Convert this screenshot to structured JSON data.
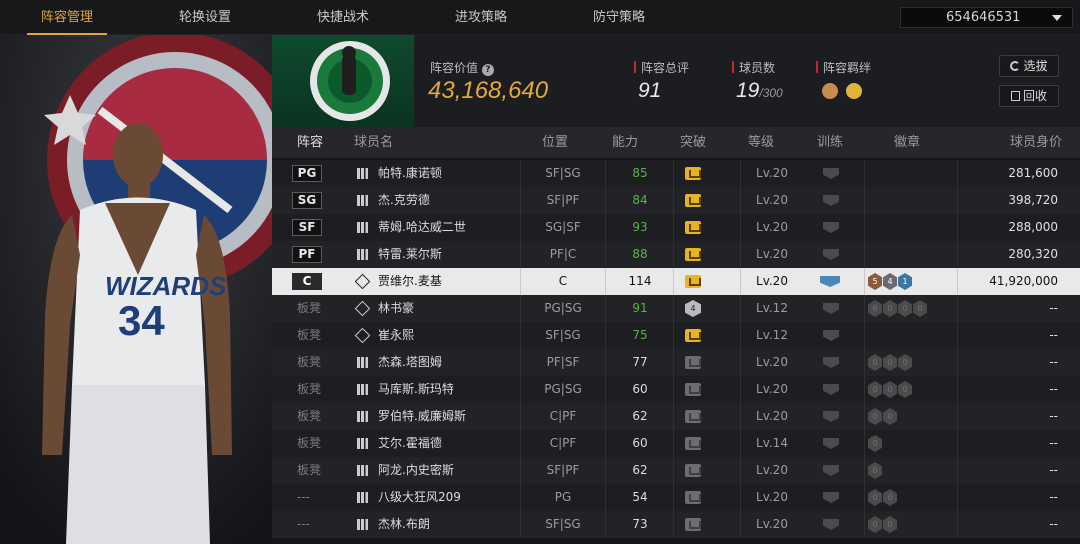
{
  "tabs": [
    "阵容管理",
    "轮换设置",
    "快捷战术",
    "进攻策略",
    "防守策略"
  ],
  "account": "654646531",
  "header": {
    "value_label": "阵容价值",
    "value": "43,168,640",
    "rating_label": "阵容总评",
    "rating": "91",
    "players_label": "球员数",
    "players": "19",
    "players_max": "/300",
    "bond_label": "阵容羁绊",
    "btn_select": "选拔",
    "btn_recycle": "回收"
  },
  "columns": [
    "阵容",
    "球员名",
    "位置",
    "能力",
    "突破",
    "等级",
    "训练",
    "徽章",
    "球员身价"
  ],
  "featured_player_jersey": "34",
  "rows": [
    {
      "slot": "PG",
      "name": "帕特.康诺顿",
      "pos": "SF|SG",
      "ability": "85",
      "green": true,
      "breakthrough": "gold",
      "level": "Lv.20",
      "badges": [],
      "value": "281,600"
    },
    {
      "slot": "SG",
      "name": "杰.克劳德",
      "pos": "SF|PF",
      "ability": "84",
      "green": true,
      "breakthrough": "gold",
      "level": "Lv.20",
      "badges": [],
      "value": "398,720"
    },
    {
      "slot": "SF",
      "name": "蒂姆.哈达威二世",
      "pos": "SG|SF",
      "ability": "93",
      "green": true,
      "breakthrough": "gold",
      "level": "Lv.20",
      "badges": [],
      "value": "288,000"
    },
    {
      "slot": "PF",
      "name": "特雷.莱尔斯",
      "pos": "PF|C",
      "ability": "88",
      "green": true,
      "breakthrough": "gold",
      "level": "Lv.20",
      "badges": [],
      "value": "280,320"
    },
    {
      "slot": "C",
      "name": "贾维尔.麦基",
      "pos": "C",
      "ability": "114",
      "green": false,
      "breakthrough": "gold",
      "level": "Lv.20",
      "badges": [
        "5",
        "4",
        "1"
      ],
      "value": "41,920,000",
      "selected": true
    },
    {
      "slot": "板凳",
      "name": "林书豪",
      "pos": "PG|SG",
      "ability": "91",
      "green": true,
      "breakthrough": "4",
      "level": "Lv.12",
      "badges": [
        "6",
        "0",
        "0",
        "0"
      ],
      "value": "--"
    },
    {
      "slot": "板凳",
      "name": "崔永熙",
      "pos": "SF|SG",
      "ability": "75",
      "green": true,
      "breakthrough": "gold",
      "level": "Lv.12",
      "badges": [],
      "value": "--"
    },
    {
      "slot": "板凳",
      "name": "杰森.塔图姆",
      "pos": "PF|SF",
      "ability": "77",
      "green": false,
      "breakthrough": "grey",
      "level": "Lv.20",
      "badges": [
        "0",
        "0",
        "0"
      ],
      "value": "--"
    },
    {
      "slot": "板凳",
      "name": "马库斯.斯玛特",
      "pos": "PG|SG",
      "ability": "60",
      "green": false,
      "breakthrough": "grey",
      "level": "Lv.20",
      "badges": [
        "0",
        "0",
        "0"
      ],
      "value": "--"
    },
    {
      "slot": "板凳",
      "name": "罗伯特.威廉姆斯",
      "pos": "C|PF",
      "ability": "62",
      "green": false,
      "breakthrough": "grey",
      "level": "Lv.20",
      "badges": [
        "0",
        "0"
      ],
      "value": "--"
    },
    {
      "slot": "板凳",
      "name": "艾尔.霍福德",
      "pos": "C|PF",
      "ability": "60",
      "green": false,
      "breakthrough": "grey",
      "level": "Lv.14",
      "badges": [
        "0"
      ],
      "value": "--"
    },
    {
      "slot": "板凳",
      "name": "阿龙.内史密斯",
      "pos": "SF|PF",
      "ability": "62",
      "green": false,
      "breakthrough": "grey",
      "level": "Lv.20",
      "badges": [
        "0"
      ],
      "value": "--"
    },
    {
      "slot": "---",
      "name": "八级大狂风209",
      "pos": "PG",
      "ability": "54",
      "green": false,
      "breakthrough": "grey",
      "level": "Lv.20",
      "badges": [
        "0",
        "0"
      ],
      "value": "--"
    },
    {
      "slot": "---",
      "name": "杰林.布朗",
      "pos": "SF|SG",
      "ability": "73",
      "green": false,
      "breakthrough": "grey",
      "level": "Lv.20",
      "badges": [
        "0",
        "0"
      ],
      "value": "--"
    }
  ]
}
